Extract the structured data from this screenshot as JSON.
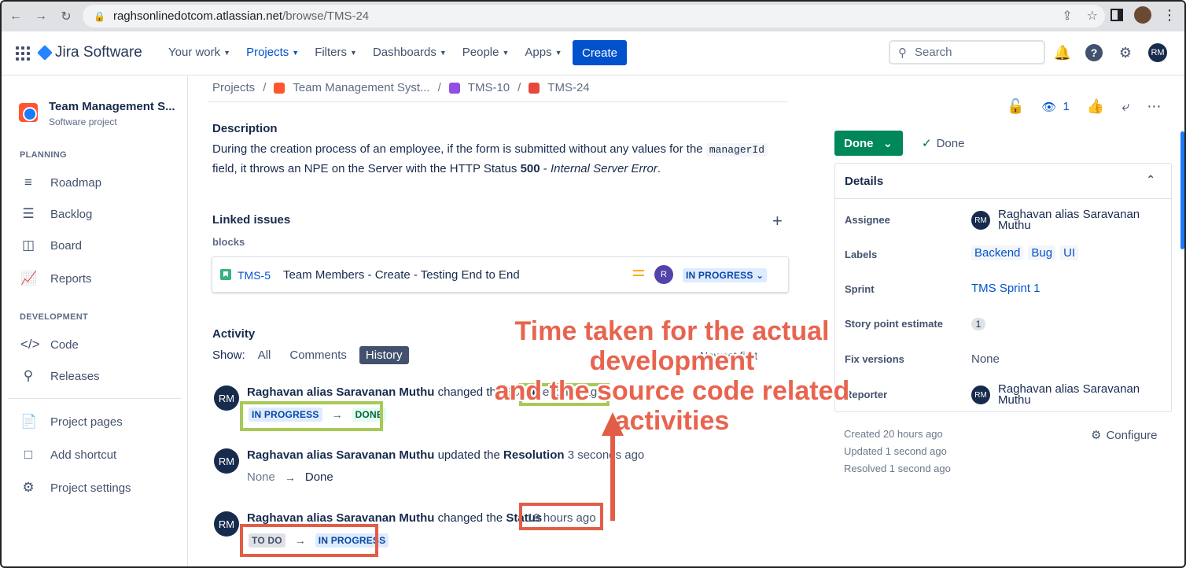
{
  "browser": {
    "url_host": "raghsonlinedotcom.atlassian.net",
    "url_path": "/browse/TMS-24"
  },
  "topnav": {
    "product": "Jira Software",
    "items": [
      "Your work",
      "Projects",
      "Filters",
      "Dashboards",
      "People",
      "Apps"
    ],
    "active_item": "Projects",
    "create_label": "Create",
    "search_placeholder": "Search",
    "avatar_initials": "RM"
  },
  "sidebar": {
    "project_name": "Team Management S...",
    "project_type": "Software project",
    "planning_heading": "PLANNING",
    "planning_items": [
      "Roadmap",
      "Backlog",
      "Board",
      "Reports"
    ],
    "development_heading": "DEVELOPMENT",
    "development_items": [
      "Code",
      "Releases"
    ],
    "bottom_items": [
      "Project pages",
      "Add shortcut",
      "Project settings"
    ]
  },
  "breadcrumb": {
    "root": "Projects",
    "project": "Team Management Syst...",
    "parent": "TMS-10",
    "issue": "TMS-24"
  },
  "description": {
    "title": "Description",
    "text_before_code": "During the creation process of an employee, if the form is submitted without any values for the ",
    "code": "managerId",
    "text_after_code": " field, it throws an NPE on the Server with the HTTP Status ",
    "status_code": "500",
    "dash": " - ",
    "error_text": "Internal Server Error",
    "period": "."
  },
  "linked": {
    "title": "Linked issues",
    "relation": "blocks",
    "key": "TMS-5",
    "summary": "Team Members - Create - Testing End to End",
    "assignee_initial": "R",
    "status": "IN PROGRESS"
  },
  "activity": {
    "title": "Activity",
    "show_label": "Show:",
    "filters": [
      "All",
      "Comments",
      "History"
    ],
    "active_filter": "History",
    "sort_label": "Newest first",
    "entries": [
      {
        "initials": "RM",
        "user": "Raghavan alias Saravanan Muthu",
        "action": "changed the",
        "field": "Status",
        "ago": "3 seconds ago",
        "from": "IN PROGRESS",
        "to": "DONE"
      },
      {
        "initials": "RM",
        "user": "Raghavan alias Saravanan Muthu",
        "action": "updated the",
        "field": "Resolution",
        "ago": "3 seconds ago",
        "from": "None",
        "to": "Done"
      },
      {
        "initials": "RM",
        "user": "Raghavan alias Saravanan Muthu",
        "action": "changed the",
        "field": "Status",
        "ago": "19 hours ago",
        "from": "TO DO",
        "to": "IN PROGRESS"
      }
    ]
  },
  "right_panel": {
    "watch_count": "1",
    "status_button": "Done",
    "resolution": "Done",
    "details_title": "Details",
    "assignee_label": "Assignee",
    "assignee_initials": "RM",
    "assignee_name": "Raghavan alias Saravanan Muthu",
    "labels_label": "Labels",
    "labels": [
      "Backend",
      "Bug",
      "UI"
    ],
    "sprint_label": "Sprint",
    "sprint": "TMS Sprint 1",
    "story_points_label": "Story point estimate",
    "story_points": "1",
    "fix_versions_label": "Fix versions",
    "fix_versions": "None",
    "reporter_label": "Reporter",
    "reporter_initials": "RM",
    "reporter_name": "Raghavan alias Saravanan Muthu",
    "created": "Created 20 hours ago",
    "updated": "Updated 1 second ago",
    "resolved": "Resolved 1 second ago",
    "configure": "Configure"
  },
  "annotation": {
    "line1": "Time taken for the actual development",
    "line2": "and the source code related activities"
  },
  "colors": {
    "primary": "#0052cc",
    "done_green": "#00875a",
    "highlight_green": "#a7c957",
    "highlight_red": "#e25d47",
    "annotation_red": "#e8644f"
  }
}
